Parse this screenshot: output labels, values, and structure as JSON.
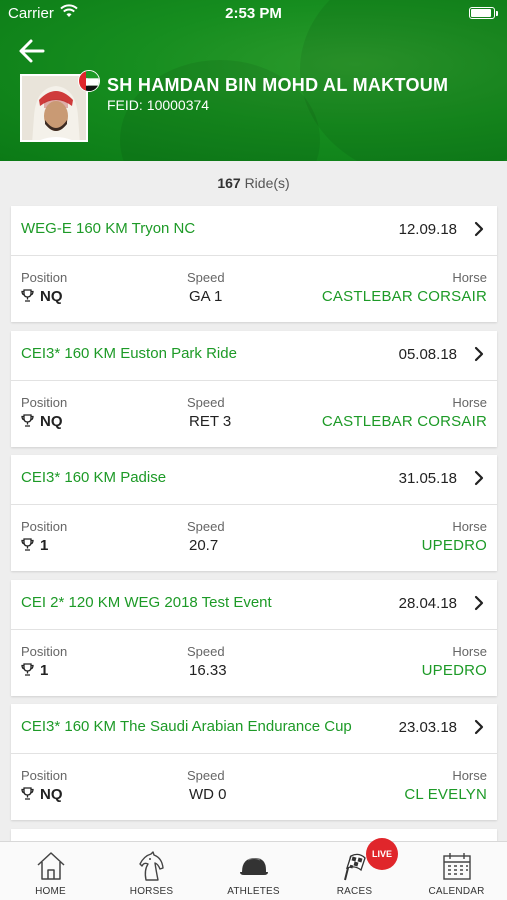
{
  "status_bar": {
    "carrier": "Carrier",
    "time": "2:53 PM"
  },
  "athlete": {
    "name": "SH HAMDAN BIN MOHD AL MAKTOUM",
    "feid_label": "FEID:",
    "feid": "10000374"
  },
  "rides": {
    "count": "167",
    "suffix": "Ride(s)"
  },
  "labels": {
    "position": "Position",
    "speed": "Speed",
    "horse": "Horse"
  },
  "colors": {
    "header_green": "#168d1f",
    "accent_green": "#1d9a27",
    "live_red": "#e0262b"
  },
  "results": [
    {
      "event": "WEG-E 160 KM Tryon NC",
      "date": "12.09.18",
      "position": "NQ",
      "speed": "GA 1",
      "horse": "CASTLEBAR CORSAIR"
    },
    {
      "event": "CEI3* 160 KM Euston Park Ride",
      "date": "05.08.18",
      "position": "NQ",
      "speed": "RET 3",
      "horse": "CASTLEBAR CORSAIR"
    },
    {
      "event": "CEI3* 160 KM Padise",
      "date": "31.05.18",
      "position": "1",
      "speed": "20.7",
      "horse": "UPEDRO"
    },
    {
      "event": "CEI 2* 120 KM WEG 2018 Test Event",
      "date": "28.04.18",
      "position": "1",
      "speed": "16.33",
      "horse": "UPEDRO"
    },
    {
      "event": "CEI3* 160 KM The Saudi Arabian Endurance Cup",
      "date": "23.03.18",
      "position": "NQ",
      "speed": "WD 0",
      "horse": "CL EVELYN"
    }
  ],
  "tabs": [
    {
      "label": "HOME",
      "icon": "home-icon"
    },
    {
      "label": "HORSES",
      "icon": "horse-icon"
    },
    {
      "label": "ATHLETES",
      "icon": "helmet-icon"
    },
    {
      "label": "RACES",
      "icon": "checkered-flag-icon",
      "badge": "LIVE"
    },
    {
      "label": "CALENDAR",
      "icon": "calendar-icon"
    }
  ]
}
